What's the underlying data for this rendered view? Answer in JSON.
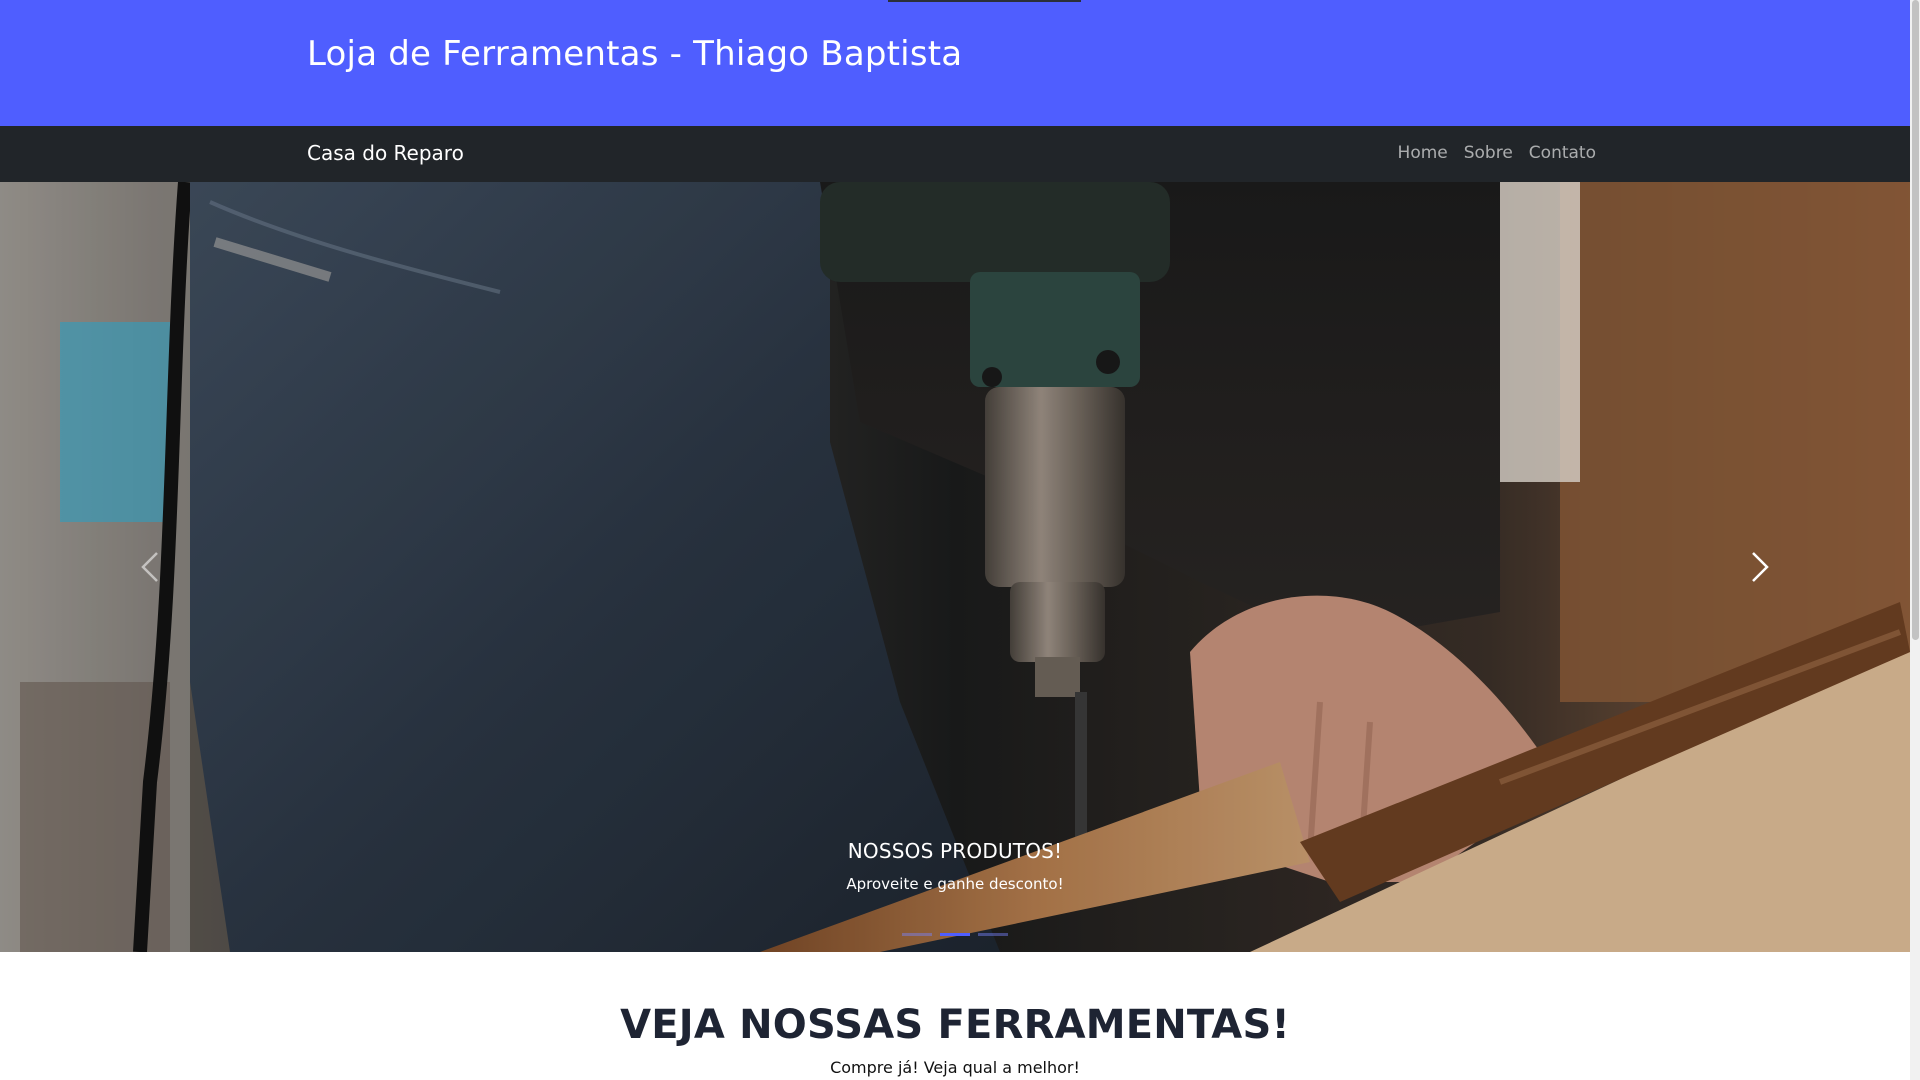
{
  "header": {
    "title": "Loja de Ferramentas - Thiago Baptista"
  },
  "navbar": {
    "brand": "Casa do Reparo",
    "links": [
      "Home",
      "Sobre",
      "Contato"
    ]
  },
  "carousel": {
    "caption_title": "NOSSOS PRODUTOS!",
    "caption_text": "Aproveite e ganhe desconto!",
    "slide_count": 3,
    "active_slide": 2,
    "prev_icon": "chevron-left-icon",
    "next_icon": "chevron-right-icon"
  },
  "section": {
    "title": "VEJA NOSSAS FERRAMENTAS!",
    "subtitle": "Compre já! Veja qual a melhor!"
  },
  "colors": {
    "header_bg": "#4f5eff",
    "navbar_bg": "#212529",
    "accent": "#4f5eff"
  }
}
